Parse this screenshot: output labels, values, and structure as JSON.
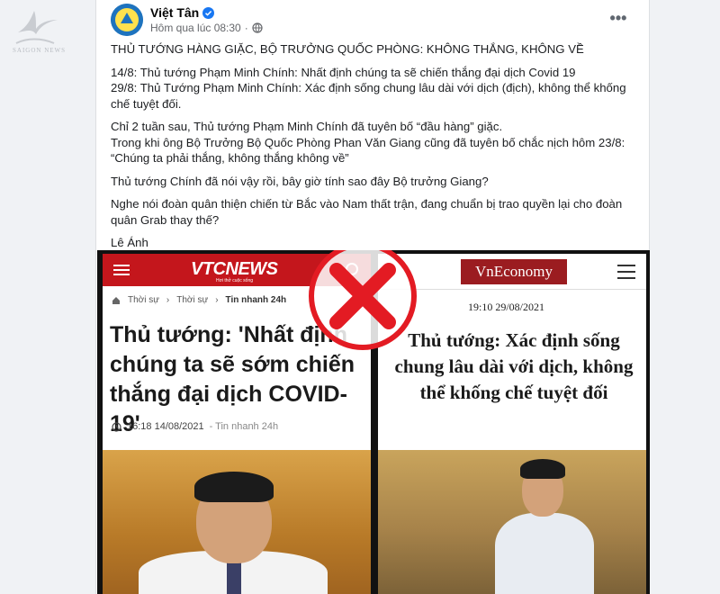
{
  "watermark": {
    "label": "SAIGON NEWS"
  },
  "post": {
    "author": "Việt Tân",
    "timestamp": "Hôm qua lúc 08:30",
    "privacy_icon": "globe-icon",
    "more_icon": "ellipsis-icon",
    "more_label": "•••",
    "headline": "THỦ TƯỚNG HÀNG GIẶC, BỘ TRƯỞNG QUỐC PHÒNG: KHÔNG THẮNG, KHÔNG VỀ",
    "para1": "14/8: Thủ tướng Phạm Minh Chính: Nhất định chúng ta sẽ chiến thắng đại dịch Covid 19\n29/8: Thủ Tướng Phạm Minh Chính: Xác định sống chung lâu dài với dịch (địch), không thể khống chế tuyệt đối.",
    "para2": "Chỉ 2 tuần sau, Thủ tướng Phạm Minh Chính đã tuyên bố “đầu hàng” giặc.\nTrong khi ông Bộ Trưởng Bộ Quốc Phòng Phan Văn Giang cũng đã tuyên bố chắc nịch hôm 23/8: “Chúng ta phải thắng, không thắng không về”",
    "para3": "Thủ tướng Chính đã nói vậy rồi, bây giờ tính sao đây Bộ trưởng Giang?",
    "para4": "Nghe nói đoàn quân thiện chiến từ Bắc vào Nam thất trận, đang chuẩn bị trao quyền lại cho đoàn quân Grab thay thế?",
    "signature": "Lê Ánh"
  },
  "image": {
    "left": {
      "brand": "VTCNEWS",
      "tagline": "Hơi thở cuộc sống",
      "breadcrumbs": [
        "Thời sự",
        "Thời sự",
        "Tin nhanh 24h"
      ],
      "title": "Thủ tướng: 'Nhất định chúng ta sẽ sớm chiến thắng đại dịch COVID-19'",
      "date": "16:18 14/08/2021",
      "category": "- Tin nhanh 24h"
    },
    "right": {
      "brand": "VnEconomy",
      "date": "19:10 29/08/2021",
      "title": "Thủ tướng: Xác định sống chung lâu dài với dịch, không thể khống chế tuyệt đối"
    },
    "overlay_icon": "red-x-icon"
  },
  "colors": {
    "vtc_red": "#c4161c",
    "vne_red": "#9b1c20",
    "x_red": "#e31b23"
  }
}
